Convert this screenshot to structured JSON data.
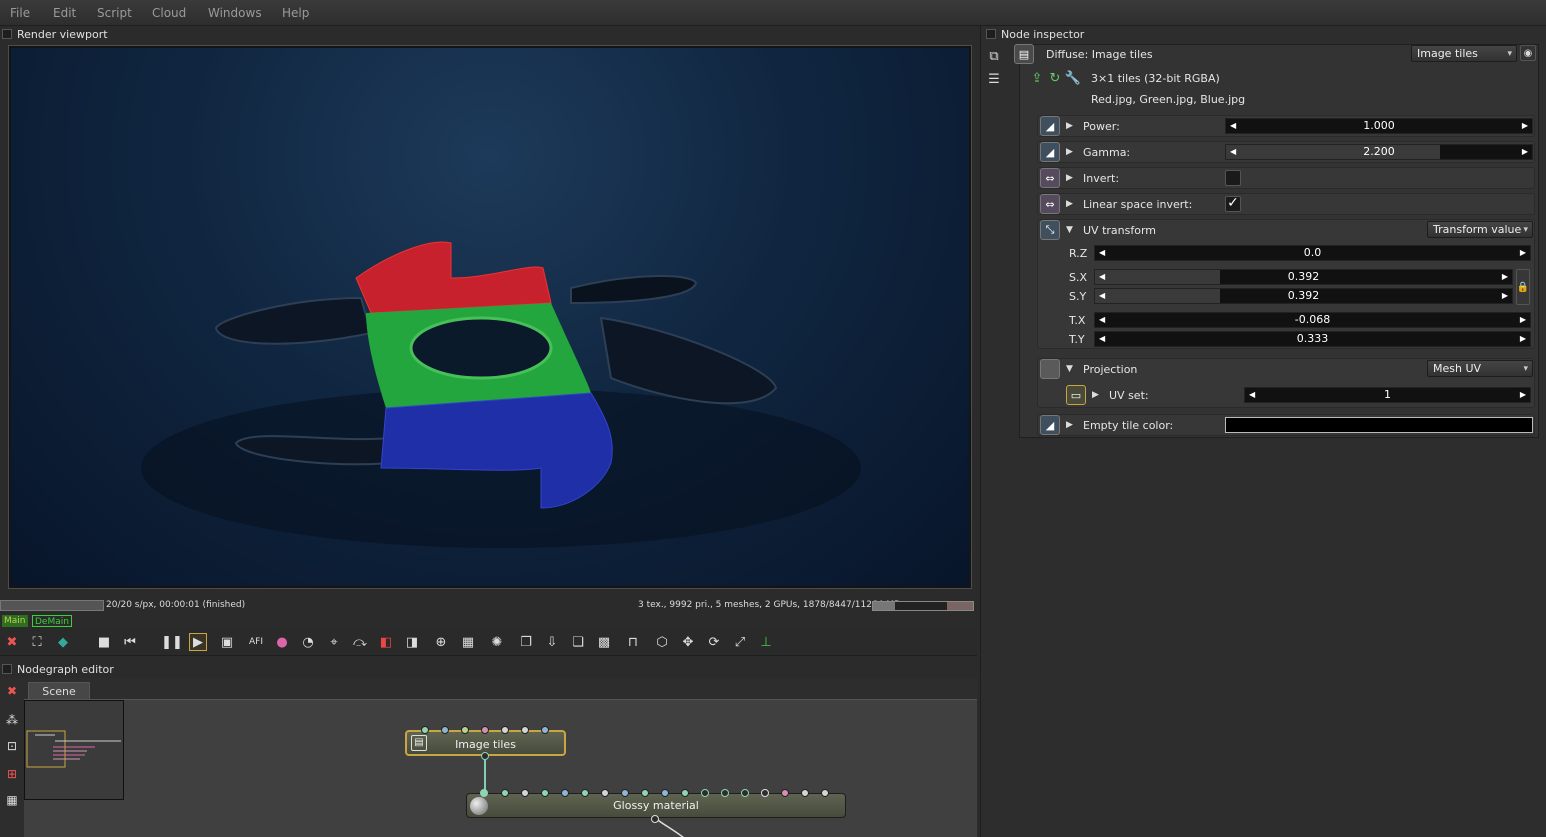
{
  "menu": [
    "File",
    "Edit",
    "Script",
    "Cloud",
    "Windows",
    "Help"
  ],
  "render_viewport": {
    "title": "Render viewport",
    "status_left": "20/20 s/px, 00:00:01 (finished)",
    "status_right": "3 tex., 9992 pri., 5 meshes, 2 GPUs, 1878/8447/11264 MB",
    "memory_fraction": 0.22,
    "tags": {
      "main": "Main",
      "demain": "DeMain"
    }
  },
  "toolbar_icons": [
    "reset-icon",
    "focus-icon",
    "color-cube-icon",
    "stop-icon",
    "rewind-icon",
    "pause-icon",
    "play-icon",
    "display-icon",
    "text-icon",
    "color-wheel-icon",
    "sphere-icon",
    "picker-icon",
    "pick-icon",
    "pick2-icon",
    "pick3-icon",
    "magnify-icon",
    "region-icon",
    "spinner-icon",
    "copy-icon",
    "export-icon",
    "layers-icon",
    "grid-icon",
    "lock-icon",
    "cube-icon",
    "move-icon",
    "rotate-icon",
    "fullscreen-icon",
    "axis-icon"
  ],
  "nodegraph": {
    "title": "Nodegraph editor",
    "tab": "Scene",
    "nodes": {
      "image_tiles": "Image tiles",
      "glossy_material": "Glossy material"
    }
  },
  "inspector": {
    "title": "Node inspector",
    "header_label": "Diffuse: Image tiles",
    "header_dropdown": "Image tiles",
    "info_line1": "3×1 tiles (32-bit RGBA)",
    "info_line2": "Red.jpg, Green.jpg, Blue.jpg",
    "power": {
      "label": "Power:",
      "value": "1.000",
      "fraction": 0.0
    },
    "gamma": {
      "label": "Gamma:",
      "value": "2.200",
      "fraction": 0.7
    },
    "invert": {
      "label": "Invert:",
      "checked": false
    },
    "linear_space_invert": {
      "label": "Linear space invert:",
      "checked": true,
      "mark": "✓"
    },
    "uv_transform": {
      "label": "UV transform",
      "dropdown": "Transform value",
      "rz": {
        "label": "R.Z",
        "value": "0.0"
      },
      "sx": {
        "label": "S.X",
        "value": "0.392",
        "fraction": 0.3
      },
      "sy": {
        "label": "S.Y",
        "value": "0.392",
        "fraction": 0.3
      },
      "tx": {
        "label": "T.X",
        "value": "-0.068"
      },
      "ty": {
        "label": "T.Y",
        "value": "0.333"
      }
    },
    "projection": {
      "label": "Projection",
      "dropdown": "Mesh UV",
      "uv_set": {
        "label": "UV set:",
        "value": "1"
      }
    },
    "empty_tile_color": {
      "label": "Empty tile color:",
      "color": "#000000"
    }
  }
}
